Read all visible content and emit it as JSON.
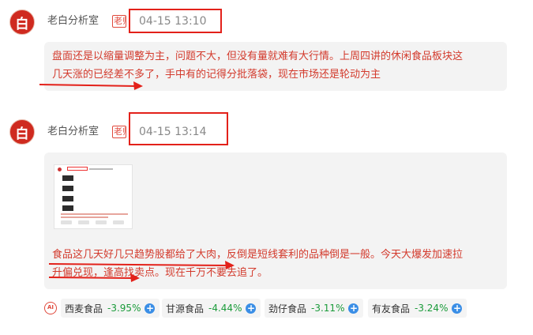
{
  "posts": [
    {
      "avatar_glyph": "白",
      "author": "老白分析室",
      "role_badge": "老师",
      "timestamp": "04-15 13:10",
      "message_lines": [
        "盘面还是以缩量调整为主，问题不大，但没有量就难有大行情。上周四讲的休闲食品板块这",
        "几天涨的已经差不多了，手中有的记得分批落袋，现在市场还是轮动为主"
      ]
    },
    {
      "avatar_glyph": "白",
      "author": "老白分析室",
      "role_badge": "老师",
      "timestamp": "04-15 13:14",
      "message_lines": [
        "食品这几天好几只趋势股都给了大肉，反倒是短线套利的品种倒是一般。今天大爆发加速拉",
        "升偏兑现，逢高找卖点。现在千万不要去追了。"
      ],
      "has_image": true
    }
  ],
  "ai_icon_label": "AI",
  "related_stocks": [
    {
      "name": "西麦食品",
      "change": "-3.95%"
    },
    {
      "name": "甘源食品",
      "change": "-4.44%"
    },
    {
      "name": "劲仔食品",
      "change": "-3.11%"
    },
    {
      "name": "有友食品",
      "change": "-3.24%"
    }
  ],
  "colors": {
    "accent_red": "#e3211a",
    "message_text": "#d33a2c",
    "down_green": "#1a9b3a",
    "add_blue": "#3a8ee6"
  }
}
